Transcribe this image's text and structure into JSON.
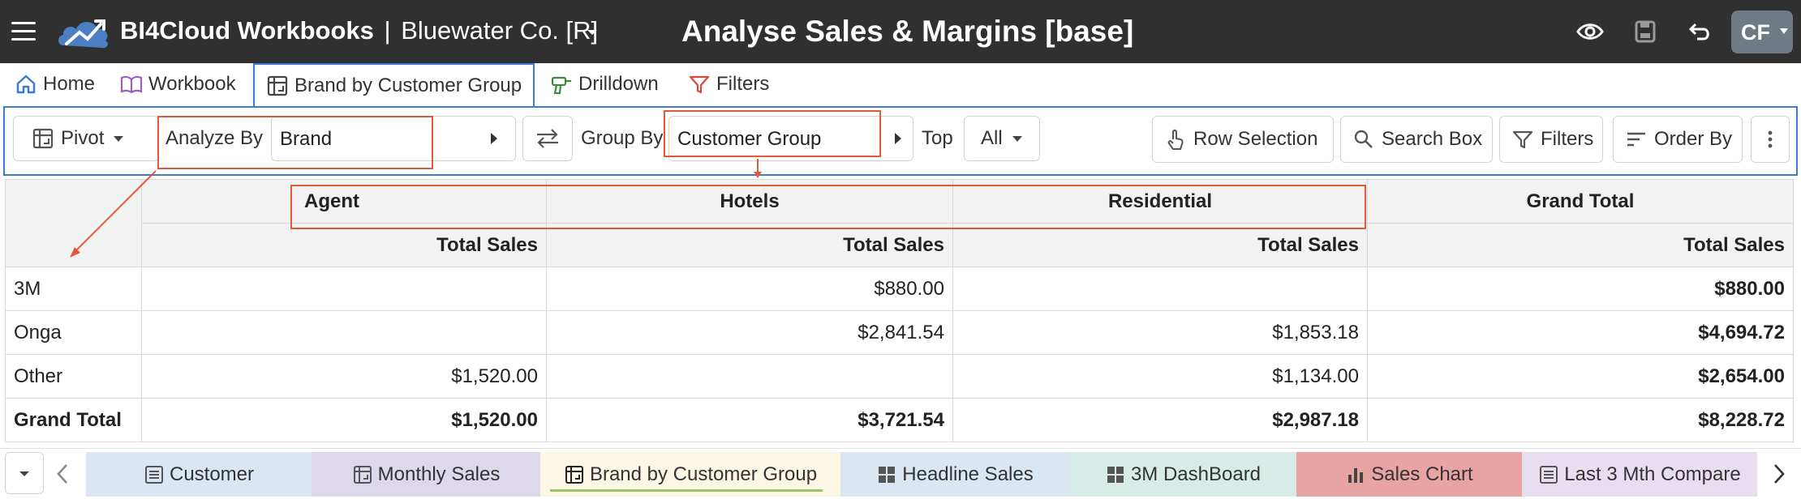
{
  "header": {
    "app_name": "BI4Cloud Workbooks",
    "separator": "|",
    "company": "Bluewater Co. [R]",
    "page_title": "Analyse Sales & Margins [base]",
    "icons": [
      "menu-icon",
      "cloud-logo",
      "chevron-down-icon",
      "eye-icon",
      "save-icon",
      "undo-icon"
    ],
    "avatar_initials": "CF",
    "bg_color": "#303030",
    "avatar_color": "#6f7a85"
  },
  "nav_tabs": [
    {
      "label": "Home",
      "icon": "home-icon"
    },
    {
      "label": "Workbook",
      "icon": "book-icon"
    },
    {
      "label": "Brand by Customer Group",
      "icon": "pivot-icon",
      "active": true
    },
    {
      "label": "Drilldown",
      "icon": "drill-icon"
    },
    {
      "label": "Filters",
      "icon": "filter-icon"
    }
  ],
  "toolbar": {
    "pivot_label": "Pivot",
    "analyze_by_label": "Analyze By",
    "analyze_by_value": "Brand",
    "group_by_label": "Group By",
    "group_by_value": "Customer Group",
    "top_label": "Top",
    "top_value": "All",
    "row_selection_label": "Row Selection",
    "search_box_label": "Search Box",
    "filters_label": "Filters",
    "order_by_label": "Order By",
    "accent_color": "#3c7bd0",
    "highlight_color": "#e05a3a"
  },
  "table": {
    "column_groups": [
      "Agent",
      "Hotels",
      "Residential",
      "Grand Total"
    ],
    "measure": "Total Sales",
    "rows": [
      {
        "label": "3M",
        "values": [
          "",
          "$880.00",
          "",
          "$880.00"
        ]
      },
      {
        "label": "Onga",
        "values": [
          "",
          "$2,841.54",
          "$1,853.18",
          "$4,694.72"
        ]
      },
      {
        "label": "Other",
        "values": [
          "$1,520.00",
          "",
          "$1,134.00",
          "$2,654.00"
        ]
      }
    ],
    "grand_total": {
      "label": "Grand Total",
      "values": [
        "$1,520.00",
        "$3,721.54",
        "$2,987.18",
        "$8,228.72"
      ]
    }
  },
  "sheet_tabs": [
    {
      "label": "Customer",
      "icon": "list-icon",
      "color": "#dbe6f3"
    },
    {
      "label": "Monthly Sales",
      "icon": "pivot-icon",
      "color": "#ddd8ea"
    },
    {
      "label": "Brand by Customer Group",
      "icon": "pivot-icon",
      "color": "#fbf7e4",
      "active": true
    },
    {
      "label": "Headline Sales",
      "icon": "dashboard-icon",
      "color": "#dbe6f3"
    },
    {
      "label": "3M DashBoard",
      "icon": "dashboard-icon",
      "color": "#d7ece6"
    },
    {
      "label": "Sales Chart",
      "icon": "bar-chart-icon",
      "color": "#e8a3a3"
    },
    {
      "label": "Last 3 Mth Compare",
      "icon": "list-icon",
      "color": "#e8def0"
    }
  ]
}
